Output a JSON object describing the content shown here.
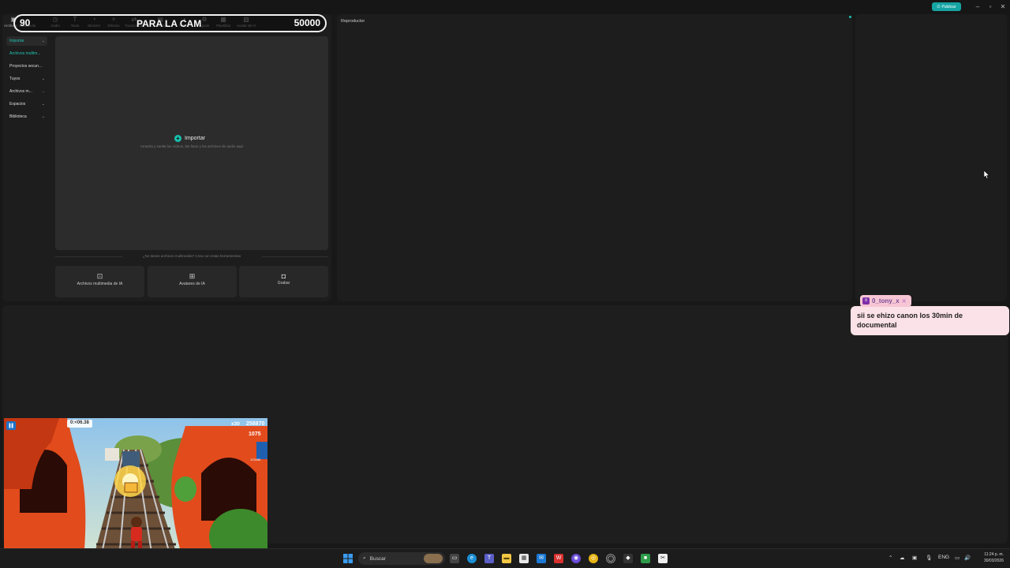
{
  "window": {
    "publish_label": "Publicar",
    "controls": [
      "minimize-icon",
      "maximize-icon",
      "close-icon"
    ]
  },
  "toolbar": {
    "items": [
      {
        "label": "Archivos multimedia",
        "icon": "media-icon"
      },
      {
        "label": "Audio",
        "icon": "audio-icon"
      },
      {
        "label": "Texto",
        "icon": "text-icon"
      },
      {
        "label": "Stickers",
        "icon": "sticker-icon"
      },
      {
        "label": "Efectos",
        "icon": "effects-icon"
      },
      {
        "label": "Transiciones",
        "icon": "transition-icon"
      },
      {
        "label": "Subtítulos",
        "icon": "caption-icon"
      },
      {
        "label": "Filtros",
        "icon": "filter-icon"
      },
      {
        "label": "Ajuste",
        "icon": "adjust-icon"
      },
      {
        "label": "Plantillas",
        "icon": "template-icon"
      },
      {
        "label": "Avatar de IA",
        "icon": "ai-avatar-icon"
      }
    ]
  },
  "overlay": {
    "left_number": "90",
    "center_text": "PARA LA CAM",
    "right_number": "50000"
  },
  "sidebar": {
    "items": [
      {
        "label": "Importar"
      },
      {
        "label": "Archivos multim..."
      },
      {
        "label": "Proyectos secun..."
      },
      {
        "label": "Tuyos"
      },
      {
        "label": "Archivos m..."
      },
      {
        "label": "Espacios"
      },
      {
        "label": "Biblioteca"
      }
    ]
  },
  "media": {
    "import_label": "Importar",
    "import_hint": "Arrastra y suelta los vídeos, las fotos y los archivos de audio aquí",
    "no_media_text": "¿No tienes archivos multimedia? Crea con estas herramientas",
    "tools": [
      {
        "label": "Archivos multimedia de IA",
        "icon": "ai-media-icon"
      },
      {
        "label": "Avatares de IA",
        "icon": "ai-avatar-icon"
      },
      {
        "label": "Grabar",
        "icon": "record-icon"
      }
    ]
  },
  "player": {
    "title": "Reproductor"
  },
  "chat": {
    "username": "0_tony_x",
    "message": "sii se ehizo canon los 30min de documental"
  },
  "game": {
    "timer": "0:<06.38",
    "multiplier": "x30",
    "score": "258870",
    "coins": "1075",
    "player_tag": "123456"
  },
  "taskbar": {
    "search_placeholder": "Buscar",
    "language": "ENG",
    "time": "11:24 p. m.",
    "date": "30/03/2026"
  },
  "colors": {
    "accent": "#19c2b0",
    "chat_bg": "#fbe1e8",
    "chat_tag": "#f7c6d4"
  }
}
